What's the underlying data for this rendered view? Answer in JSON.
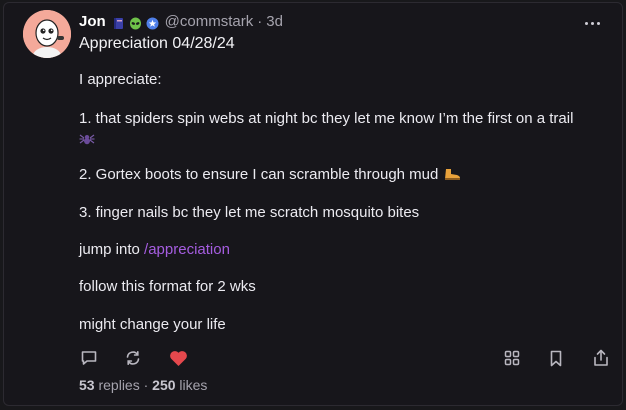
{
  "post": {
    "author_name": "Jon",
    "handle": "@commstark",
    "separator": "·",
    "time": "3d",
    "title": "Appreciation 04/28/24",
    "intro": "I appreciate:",
    "item1": "1. that spiders spin webs at night bc they let me know I’m the first on a trail",
    "item2": "2. Gortex boots to ensure I can scramble through mud",
    "item3": "3. finger nails bc they let me scratch mosquito bites",
    "jump_text": "jump into ",
    "link_text": "/appreciation",
    "follow_text": "follow this format for 2 wks",
    "closing_text": "might change your life",
    "replies_count": "53",
    "replies_label": " replies",
    "stats_separator": " · ",
    "likes_count": "250",
    "likes_label": " likes"
  },
  "icons": {
    "avatar": "cartoon-avatar-icon",
    "badge1": "book-icon",
    "badge2": "alien-icon",
    "badge3": "star-badge-icon",
    "more": "more-horizontal-icon",
    "spider": "spider-emoji-icon",
    "boot": "boot-emoji-icon",
    "reply": "reply-icon",
    "recast": "recast-icon",
    "like": "heart-icon",
    "apps": "grid-icon",
    "bookmark": "bookmark-icon",
    "share": "share-icon"
  },
  "colors": {
    "background": "#17161b",
    "link": "#a55de0",
    "heart": "#e5484d",
    "muted_text": "#a5a3ad"
  }
}
